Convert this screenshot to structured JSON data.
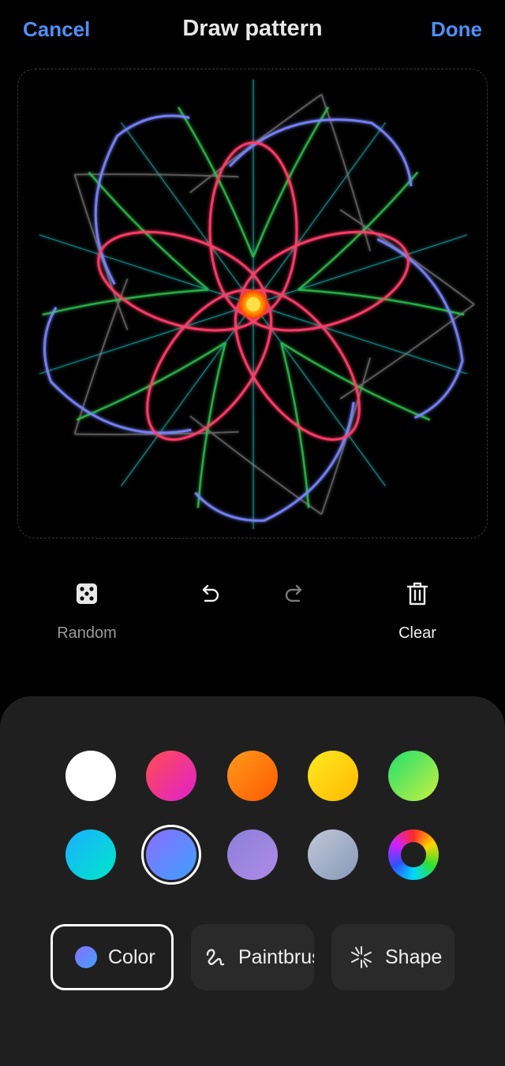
{
  "header": {
    "cancel": "Cancel",
    "title": "Draw pattern",
    "done": "Done"
  },
  "tools": {
    "random": "Random",
    "clear": "Clear"
  },
  "colors": {
    "row1": [
      "white",
      "red-pink",
      "orange",
      "yellow",
      "green"
    ],
    "row2": [
      "cyan",
      "blue-violet",
      "purple",
      "gray-blue",
      "custom-color-wheel"
    ],
    "selected": "blue-violet"
  },
  "modes": {
    "color": "Color",
    "paintbrush": "Paintbrush",
    "shape": "Shape"
  }
}
